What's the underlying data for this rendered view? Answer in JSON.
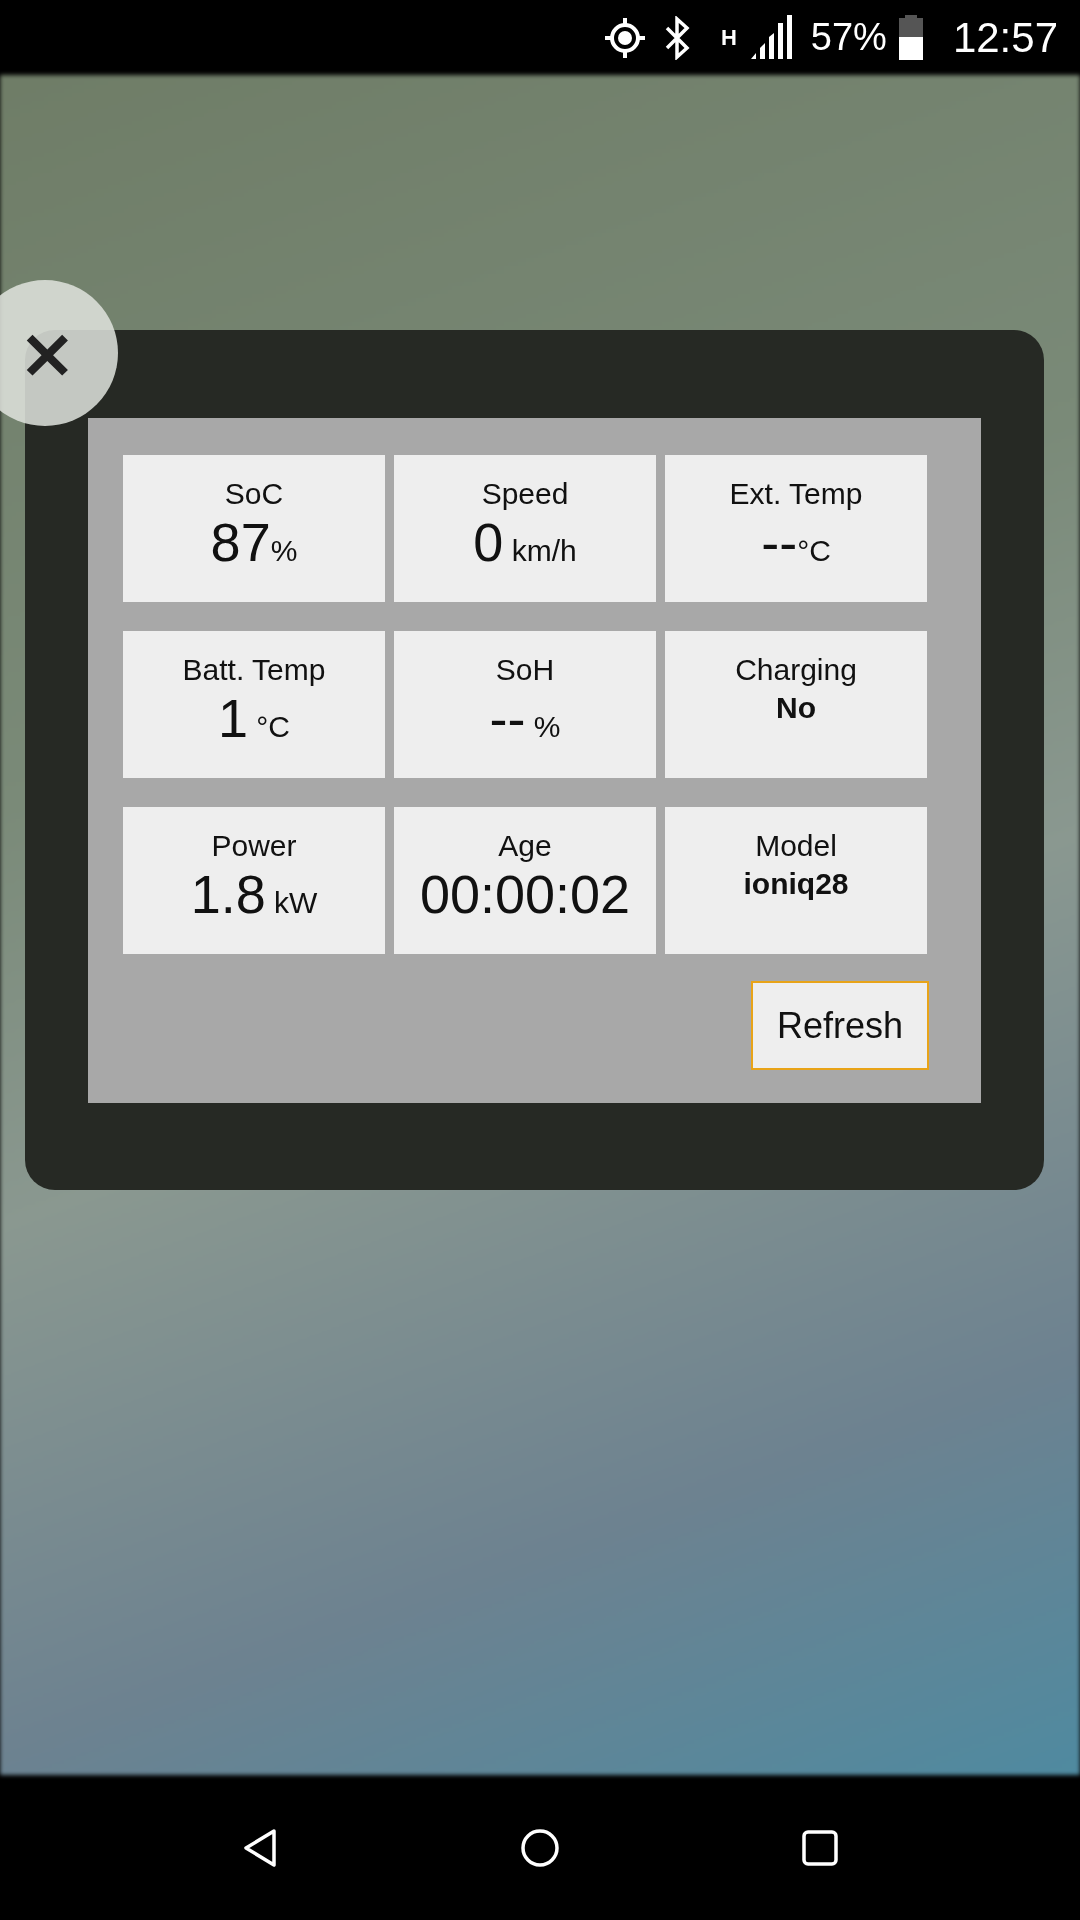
{
  "status_bar": {
    "network": "H",
    "battery": "57%",
    "time": "12:57"
  },
  "dialog": {
    "close": "×",
    "cells": [
      {
        "kind": "value",
        "label": "SoC",
        "value": "87",
        "unit": "%"
      },
      {
        "kind": "value",
        "label": "Speed",
        "value": "0",
        "unit": " km/h"
      },
      {
        "kind": "value",
        "label": "Ext. Temp",
        "value": "--",
        "unit": "°C"
      },
      {
        "kind": "value",
        "label": "Batt. Temp",
        "value": "1",
        "unit": " °C"
      },
      {
        "kind": "value",
        "label": "SoH",
        "value": "--",
        "unit": " %"
      },
      {
        "kind": "text",
        "label": "Charging",
        "value": "No"
      },
      {
        "kind": "value",
        "label": "Power",
        "value": "1.8",
        "unit": " kW"
      },
      {
        "kind": "value",
        "label": "Age",
        "value": "00:00:02"
      },
      {
        "kind": "text",
        "label": "Model",
        "value": "ioniq28"
      }
    ],
    "button": "Refresh"
  }
}
